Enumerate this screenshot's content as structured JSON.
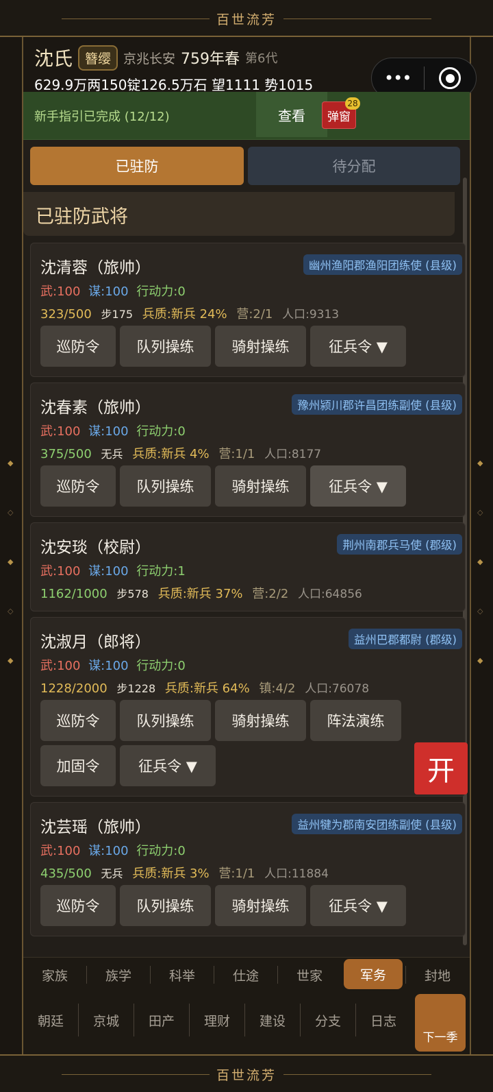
{
  "app_title": "百世流芳",
  "header": {
    "family_name": "沈氏",
    "badge": "簪缨",
    "location": "京兆长安",
    "year": "759年春",
    "generation": "第6代",
    "resources": "629.9万两150锭126.5万石  望1111 势1015"
  },
  "guide": {
    "text": "新手指引已完成 (12/12)",
    "view_label": "查看",
    "popup_label": "弹窗",
    "popup_count": "28"
  },
  "tabs": {
    "stationed": "已驻防",
    "pending": "待分配"
  },
  "section_title": "已驻防武将",
  "generals": [
    {
      "name": "沈清蓉（旅帅）",
      "title": "幽州渔阳郡渔阳团练使 (县级)",
      "wu": "武:100",
      "mou": "谋:100",
      "action": "行动力:0",
      "troops": "323/500",
      "troops_color": "#e2bb58",
      "soldier_type": "步175",
      "quality": "兵质:新兵 24%",
      "camp": "营:2/1",
      "population": "人口:9313",
      "buttons": [
        "巡防令",
        "队列操练",
        "骑射操练",
        "征兵令 ▼"
      ]
    },
    {
      "name": "沈春素（旅帅）",
      "title": "豫州颍川郡许昌团练副使 (县级)",
      "wu": "武:100",
      "mou": "谋:100",
      "action": "行动力:0",
      "troops": "375/500",
      "troops_color": "#8ed070",
      "soldier_type": "无兵",
      "quality": "兵质:新兵 4%",
      "camp": "营:1/1",
      "population": "人口:8177",
      "buttons": [
        "巡防令",
        "队列操练",
        "骑射操练",
        "征兵令 ▼"
      ]
    },
    {
      "name": "沈安琰（校尉）",
      "title": "荆州南郡兵马使 (郡级)",
      "wu": "武:100",
      "mou": "谋:100",
      "action": "行动力:1",
      "troops": "1162/1000",
      "troops_color": "#8ed070",
      "soldier_type": "步578",
      "quality": "兵质:新兵 37%",
      "camp": "营:2/2",
      "population": "人口:64856",
      "buttons": []
    },
    {
      "name": "沈淑月（郎将）",
      "title": "益州巴郡都尉 (郡级)",
      "wu": "武:100",
      "mou": "谋:100",
      "action": "行动力:0",
      "troops": "1228/2000",
      "troops_color": "#e2bb58",
      "soldier_type": "步1228",
      "quality": "兵质:新兵 64%",
      "camp": "镇:4/2",
      "population": "人口:76078",
      "buttons": [
        "巡防令",
        "队列操练",
        "骑射操练",
        "阵法演练",
        "加固令",
        "征兵令 ▼"
      ]
    },
    {
      "name": "沈芸瑶（旅帅）",
      "title": "益州犍为郡南安团练副使 (县级)",
      "wu": "武:100",
      "mou": "谋:100",
      "action": "行动力:0",
      "troops": "435/500",
      "troops_color": "#8ed070",
      "soldier_type": "无兵",
      "quality": "兵质:新兵 3%",
      "camp": "营:1/1",
      "population": "人口:11884",
      "buttons": [
        "巡防令",
        "队列操练",
        "骑射操练",
        "征兵令 ▼"
      ]
    }
  ],
  "fab_label": "开",
  "nav_row1": [
    "家族",
    "族学",
    "科举",
    "仕途",
    "世家",
    "军务",
    "封地"
  ],
  "nav_row1_active": "军务",
  "nav_row2": [
    "朝廷",
    "京城",
    "田产",
    "理财",
    "建设",
    "分支",
    "日志"
  ],
  "next_season": "下一季",
  "colors": {
    "accent": "#b47632",
    "gold": "#d4af70",
    "guide_bg": "#2e4a25",
    "fab": "#cf2f2b"
  }
}
